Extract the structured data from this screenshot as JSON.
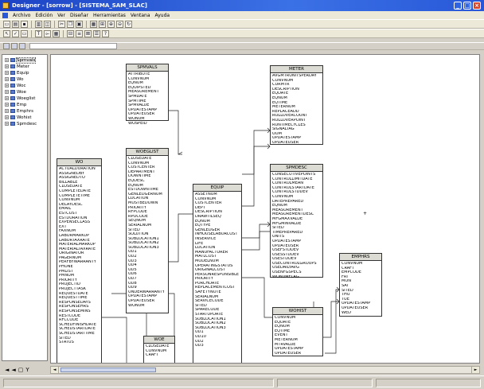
{
  "window": {
    "title": "Designer - [sorrow] - [SISTEMA_SAM_SLAC]"
  },
  "menu": [
    "Archivo",
    "Edición",
    "Ver",
    "Diseñar",
    "Herramientas",
    "Ventana",
    "Ayuda"
  ],
  "tree": [
    {
      "label": "Spmvals",
      "selected": true
    },
    {
      "label": "Meter"
    },
    {
      "label": "Equip"
    },
    {
      "label": "Wo"
    },
    {
      "label": "Woc"
    },
    {
      "label": "Woe"
    },
    {
      "label": "Woeglist"
    },
    {
      "label": "Emp"
    },
    {
      "label": "Emphrs"
    },
    {
      "label": "Wohist"
    },
    {
      "label": "Spmdesc"
    }
  ],
  "entities": {
    "spmvals": {
      "title": "SPMVALS",
      "fields": [
        "ATTRIBUTE",
        "CONVNUM",
        "EQNUM",
        "EQUIPSTED",
        "MEASUREMENT",
        "SPMDATE",
        "SPMTIME",
        "SPMVALUE",
        "UPDATESTAMP",
        "UPDATEUSER",
        "WONUM",
        "WOSPEID"
      ]
    },
    "woeglist": {
      "title": "WOEGLIST",
      "fields": [
        "CLOSEDATE",
        "CONVNUM",
        "COSTCENTER",
        "DEPARTMENT",
        "DOWNTIME",
        "EQDESC",
        "EQNUM",
        "ESTDOWNTIME",
        "GENLEDGERNUM",
        "LOCATION",
        "MUSTBEDOWN",
        "PRIORITY",
        "RFPCODE",
        "RPOCODE",
        "SEQNUM",
        "SERIALNUM",
        "SITED",
        "SOLUTION",
        "SUBLOCATION1",
        "SUBLOCATION2",
        "SUBLOCATION3",
        "UD1",
        "UD2",
        "UD3",
        "UD4",
        "UD5",
        "UD6",
        "UD7",
        "UD8",
        "UD9",
        "UNDERWARRANTY",
        "UPDATESTAMP",
        "UPDATEUSER",
        "WONUM"
      ]
    },
    "wo": {
      "title": "WO",
      "fields": [
        "ACTUALDURATION",
        "ASSIGNEDBY",
        "ASSIGNEDTO",
        "BILLABLE",
        "CLOSEDATE",
        "COMPLETEDATE",
        "COMPLETETIME",
        "CONVNUM",
        "DELAYDESC",
        "EMAIL",
        "ESTCOST",
        "ESTDURATION",
        "EXPENSECLASS",
        "EXT",
        "FAXNUM",
        "LABORMARKUP",
        "LABORTAXRATE",
        "MATERIALMARKUP",
        "MATERIALTAXRATE",
        "ORIGINATOR",
        "PAGERNUM",
        "PERFBYWARRANTY",
        "PHONE",
        "PMLIST",
        "PMNUM",
        "PRIORITY",
        "PROJECTID",
        "PROJECTTASK",
        "REQUESTDATE",
        "REQUESTTIME",
        "RESPONSEDAYS",
        "RESPONSEHRS",
        "RESPONSEMINS",
        "RESTCODE",
        "RFCCODE",
        "SCHEDFINISHDATE",
        "SCHEDSTARTDATE",
        "SCHEDSTARTTIME",
        "SITED",
        "STATUS"
      ]
    },
    "woe": {
      "title": "WOE",
      "fields": [
        "CLOSEDATE",
        "CONVNUM",
        "CRAFT"
      ]
    },
    "equip": {
      "title": "EQUIP",
      "fields": [
        "ASSETNUM",
        "CONVNUM",
        "COSTCENTER",
        "DEPT",
        "DESCRIPTION",
        "DRAWTILSEQ",
        "EQNUM",
        "EQTYPE",
        "GENLEDGER",
        "INHOUSELABORCOST",
        "INSERVICE",
        "LIFE",
        "LOCATION",
        "MANUFACTURER",
        "MATLCOST",
        "MODELNUM",
        "OPERATINGSTATUS",
        "ORIGINALCOST",
        "PERSONRESPONSIBLE",
        "PRIORITY",
        "PURCHDATE",
        "REPLACEMENTCOST",
        "SAFETYNOTE",
        "SERIALNUM",
        "SERVICECODE",
        "SITED",
        "SPARECODE",
        "STARTUPDATE",
        "SUBLOCATION1",
        "SUBLOCATION2",
        "SUBLOCATION3",
        "UD1",
        "UD10",
        "UD2",
        "UD3"
      ]
    },
    "meter": {
      "title": "METER",
      "fields": [
        "AVGMTRUNITSPERDAY",
        "CONVNUM",
        "CURMTR",
        "DESCRIPTION",
        "EQDATE",
        "EQNUM",
        "EQTIME",
        "METERNUM",
        "REPLACEADD",
        "ROLLOVERCOUNT",
        "ROLLOVERPOINT",
        "RUNTIMECYCLES",
        "SIGNALTAG",
        "UOM",
        "UPDATESTAMP",
        "UPDATEUSER"
      ]
    },
    "spmdesc": {
      "title": "SPMDESC",
      "fields": [
        "CONSECUTIVEPOINTS",
        "CONTROLLIMITDATE",
        "CONTROLMEAN",
        "CONTROLSTARTDATE",
        "CONTROLSTDDEV",
        "CONVNUM",
        "DATEPREPARED",
        "EQNUM",
        "MEASUREMENT",
        "MEASUREMENTDESC",
        "MFGMAXVALUE",
        "MFGMINVALUE",
        "SITED",
        "TIMEPREPARED",
        "UNITS",
        "UPDATESTAMP",
        "UPDATEUSER",
        "USEFSTDDEV",
        "USESSTDDEV",
        "USESTDDEV",
        "USECONTROLGROUPS",
        "USEDAILYAVG",
        "USENFGSPECS",
        "WONUMFLAG"
      ]
    },
    "wohist": {
      "title": "WOHIST",
      "fields": [
        "CONVNUM",
        "EQDATE",
        "EQNUM",
        "EQTIME",
        "EVENT",
        "METERNUM",
        "MTRVALUE",
        "UPDATESTAMP",
        "UPDATEUSER"
      ]
    },
    "emphrs": {
      "title": "EMPHRS",
      "fields": [
        "CONVNUM",
        "CRAFT",
        "EMPCODE",
        "FRI",
        "MON",
        "SAT",
        "SITED",
        "THU",
        "TUE",
        "UPDATESTAMP",
        "UPDATEUSER",
        "WED"
      ]
    }
  },
  "status": {
    "nav": [
      "◄",
      "◄",
      "▢",
      "Y"
    ]
  }
}
